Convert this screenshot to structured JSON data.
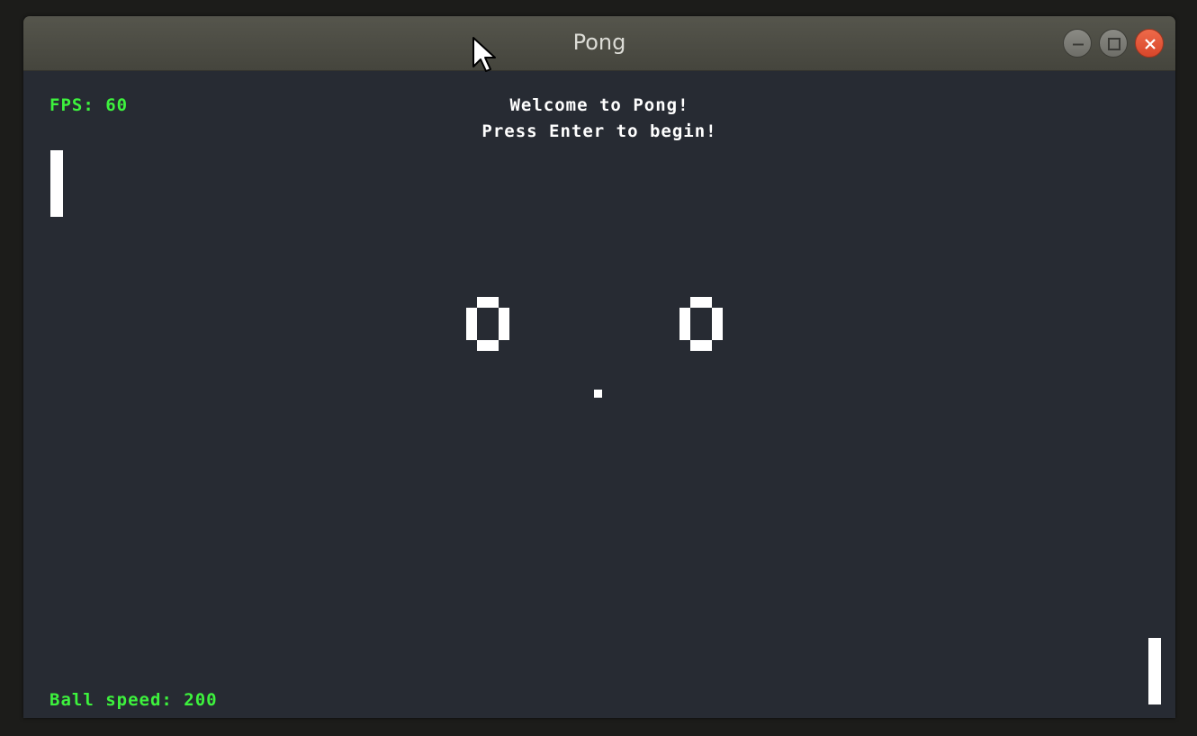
{
  "window": {
    "title": "Pong",
    "buttons": {
      "minimize": "minimize-icon",
      "maximize": "maximize-icon",
      "close": "close-icon"
    }
  },
  "hud": {
    "fps": "FPS: 60",
    "ball_speed": "Ball speed: 200"
  },
  "messages": {
    "line1": "Welcome to Pong!",
    "line2": "Press Enter to begin!"
  },
  "scores": {
    "player1": "0",
    "player2": "0"
  },
  "colors": {
    "background": "#272b33",
    "hud_text": "#3df23d",
    "foreground": "#ffffff",
    "close_button": "#e05535"
  }
}
